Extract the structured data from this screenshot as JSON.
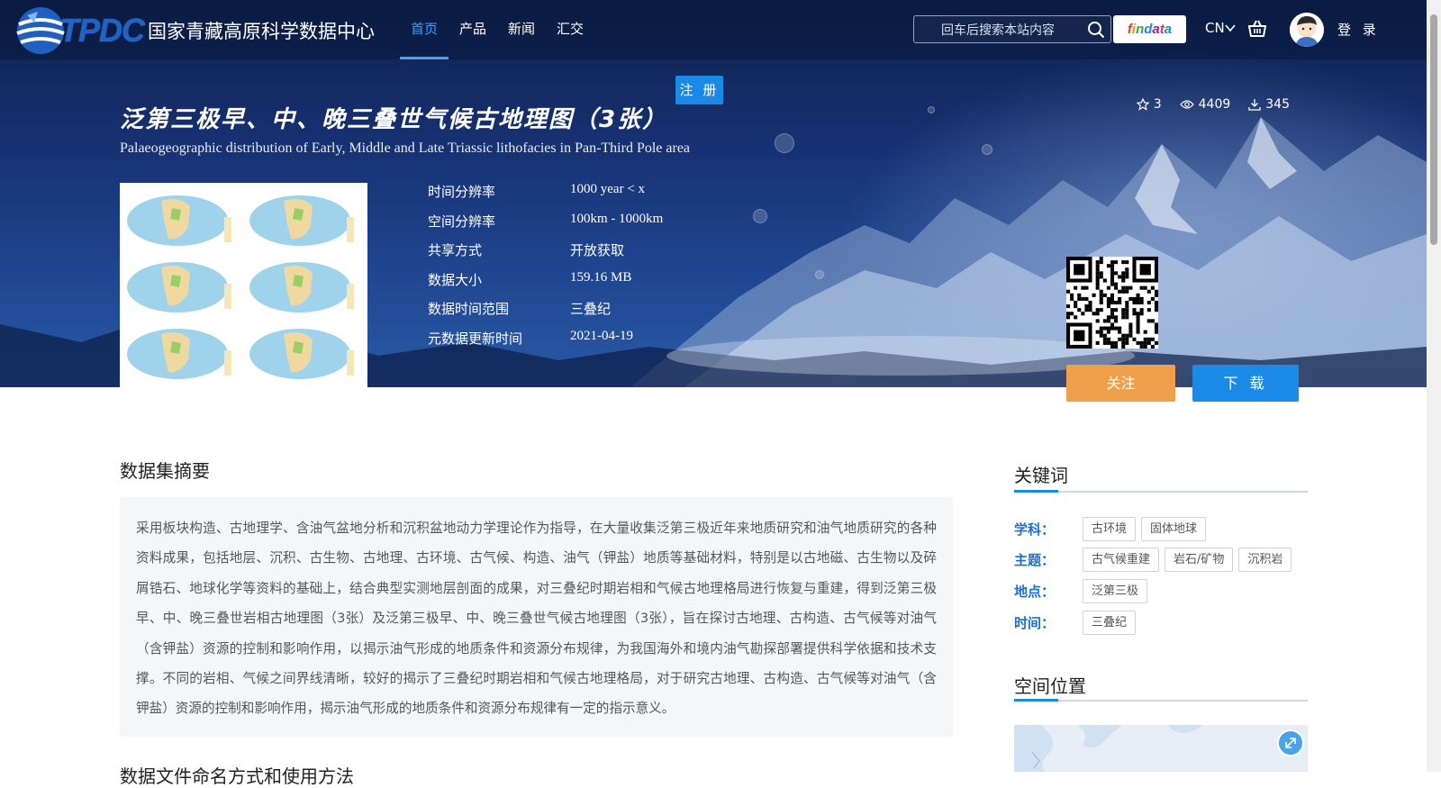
{
  "header": {
    "logo_text": "TPDC",
    "site_name": "国家青藏高原科学数据中心",
    "nav": [
      {
        "label": "首页",
        "active": true
      },
      {
        "label": "产品",
        "active": false
      },
      {
        "label": "新闻",
        "active": false
      },
      {
        "label": "汇交",
        "active": false
      }
    ],
    "search_placeholder": "回车后搜索本站内容",
    "findata_label": "findata",
    "lang": "CN",
    "login": "登 录",
    "register": "注 册"
  },
  "dataset": {
    "title_cn": "泛第三极早、中、晚三叠世气候古地理图（3张）",
    "title_en": "Palaeogeographic distribution of Early, Middle and Late Triassic lithofacies in Pan-Third Pole area",
    "stats": {
      "stars": "3",
      "views": "4409",
      "downloads": "345"
    },
    "info": [
      {
        "label": "时间分辨率",
        "value": "1000 year < x"
      },
      {
        "label": "空间分辨率",
        "value": "100km - 1000km"
      },
      {
        "label": "共享方式",
        "value": "开放获取"
      },
      {
        "label": "数据大小",
        "value": "159.16 MB"
      },
      {
        "label": "数据时间范围",
        "value": "三叠纪"
      },
      {
        "label": "元数据更新时间",
        "value": "2021-04-19"
      }
    ],
    "follow_button": "关注",
    "download_button": "下 载"
  },
  "abstract": {
    "heading": "数据集摘要",
    "text": "采用板块构造、古地理学、含油气盆地分析和沉积盆地动力学理论作为指导，在大量收集泛第三极近年来地质研究和油气地质研究的各种资料成果，包括地层、沉积、古生物、古地理、古环境、古气候、构造、油气（钾盐）地质等基础材料，特别是以古地磁、古生物以及碎屑锆石、地球化学等资料的基础上，结合典型实测地层剖面的成果，对三叠纪时期岩相和气候古地理格局进行恢复与重建，得到泛第三极早、中、晚三叠世岩相古地理图（3张）及泛第三极早、中、晚三叠世气候古地理图（3张），旨在探讨古地理、古构造、古气候等对油气（含钾盐）资源的控制和影响作用，以揭示油气形成的地质条件和资源分布规律，为我国海外和境内油气勘探部署提供科学依据和技术支撑。不同的岩相、气候之间界线清晰，较好的揭示了三叠纪时期岩相和气候古地理格局，对于研究古地理、古构造、古气候等对油气（含钾盐）资源的控制和影响作用，揭示油气形成的地质条件和资源分布规律有一定的指示意义。",
    "next_heading": "数据文件命名方式和使用方法"
  },
  "keywords": {
    "heading": "关键词",
    "rows": [
      {
        "label": "学科：",
        "tags": [
          "古环境",
          "固体地球"
        ]
      },
      {
        "label": "主题：",
        "tags": [
          "古气候重建",
          "岩石/矿物",
          "沉积岩"
        ]
      },
      {
        "label": "地点：",
        "tags": [
          "泛第三极"
        ]
      },
      {
        "label": "时间：",
        "tags": [
          "三叠纪"
        ]
      }
    ]
  },
  "spatial": {
    "heading": "空间位置"
  },
  "colors": {
    "accent": "#1b8ae6",
    "follow": "#f0a04b",
    "nav_active": "#3fa0ff"
  }
}
